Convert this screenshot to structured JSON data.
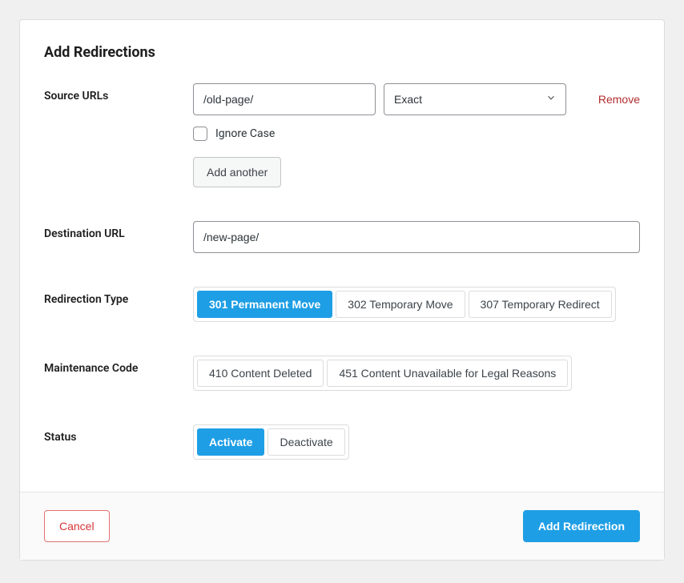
{
  "title": "Add Redirections",
  "source": {
    "label": "Source URLs",
    "url_value": "/old-page/",
    "match_options": [
      "Exact"
    ],
    "match_selected": "Exact",
    "remove_label": "Remove",
    "ignore_case_label": "Ignore Case",
    "add_another_label": "Add another"
  },
  "destination": {
    "label": "Destination URL",
    "value": "/new-page/"
  },
  "redirection_type": {
    "label": "Redirection Type",
    "options": [
      {
        "label": "301 Permanent Move",
        "active": true
      },
      {
        "label": "302 Temporary Move",
        "active": false
      },
      {
        "label": "307 Temporary Redirect",
        "active": false
      }
    ]
  },
  "maintenance_code": {
    "label": "Maintenance Code",
    "options": [
      {
        "label": "410 Content Deleted",
        "active": false
      },
      {
        "label": "451 Content Unavailable for Legal Reasons",
        "active": false
      }
    ]
  },
  "status": {
    "label": "Status",
    "options": [
      {
        "label": "Activate",
        "active": true
      },
      {
        "label": "Deactivate",
        "active": false
      }
    ]
  },
  "footer": {
    "cancel_label": "Cancel",
    "submit_label": "Add Redirection"
  }
}
